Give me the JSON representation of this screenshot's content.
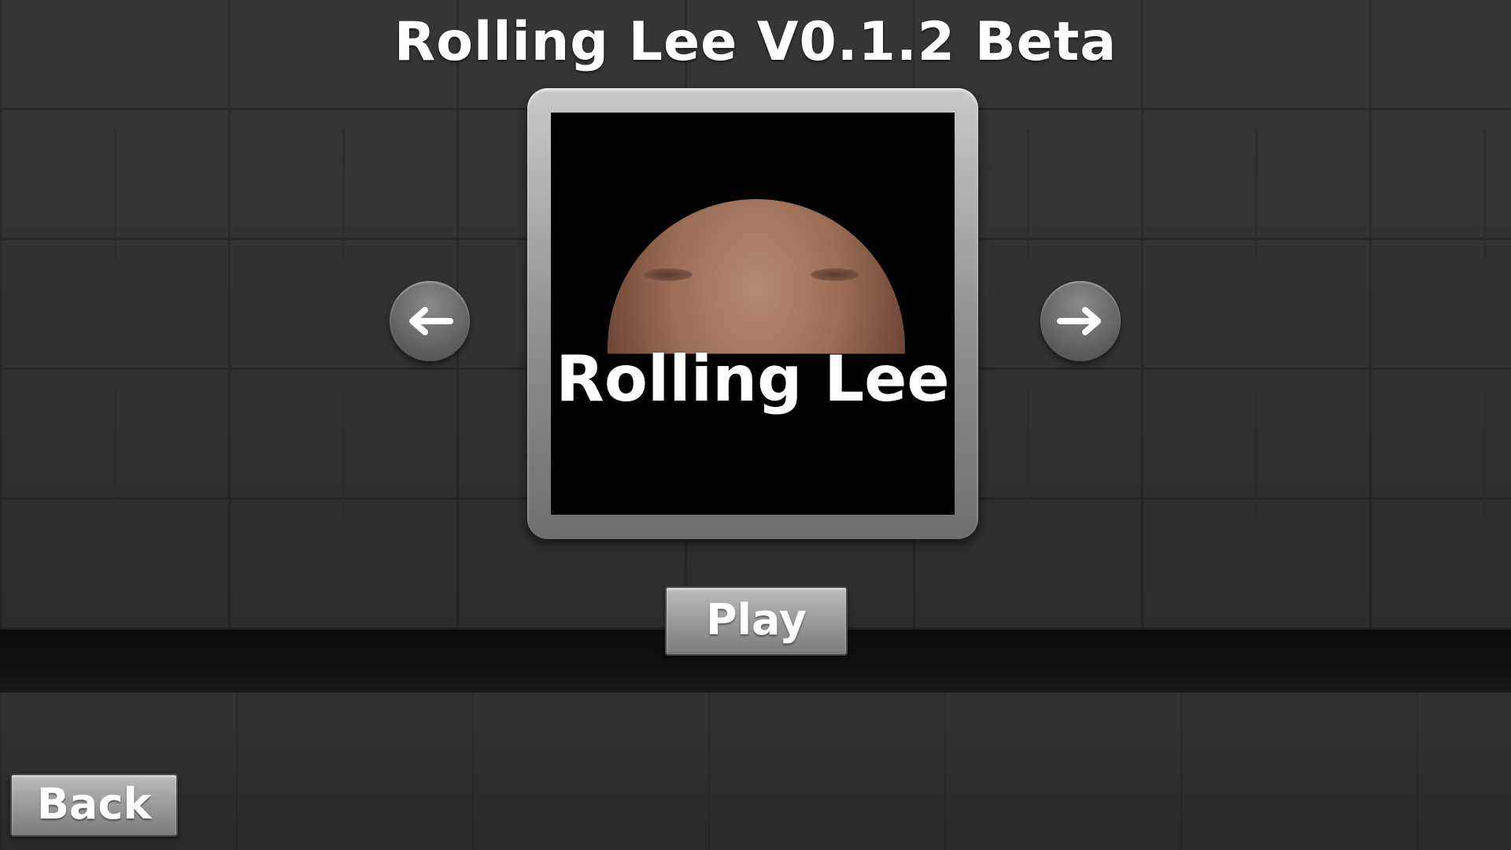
{
  "title": "Rolling Lee V0.1.2 Beta",
  "level_card": {
    "name": "Rolling Lee",
    "image_subject": "face-ball"
  },
  "navigation": {
    "prev_icon": "arrow-left-icon",
    "next_icon": "arrow-right-icon"
  },
  "buttons": {
    "play_label": "Play",
    "back_label": "Back"
  },
  "colors": {
    "wall": "#363636",
    "baseboard": "#0c0c0c",
    "floor": "#2e2e2e",
    "button_face": "#979797",
    "text": "#ffffff"
  }
}
